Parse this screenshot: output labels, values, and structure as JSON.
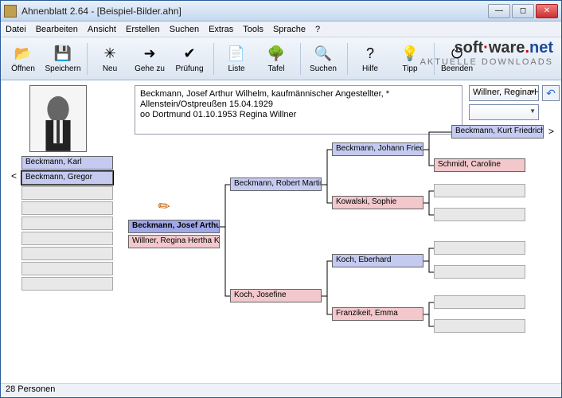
{
  "title": "Ahnenblatt 2.64 - [Beispiel-Bilder.ahn]",
  "menu": [
    "Datei",
    "Bearbeiten",
    "Ansicht",
    "Erstellen",
    "Suchen",
    "Extras",
    "Tools",
    "Sprache",
    "?"
  ],
  "toolbar": {
    "oeffnen": {
      "label": "Öffnen",
      "icon": "📂"
    },
    "speichern": {
      "label": "Speichern",
      "icon": "💾"
    },
    "neu": {
      "label": "Neu",
      "icon": "✳"
    },
    "gehezu": {
      "label": "Gehe zu",
      "icon": "➜"
    },
    "pruefung": {
      "label": "Prüfung",
      "icon": "✔"
    },
    "liste": {
      "label": "Liste",
      "icon": "📄"
    },
    "tafel": {
      "label": "Tafel",
      "icon": "🌳"
    },
    "suchen": {
      "label": "Suchen",
      "icon": "🔍"
    },
    "hilfe": {
      "label": "Hilfe",
      "icon": "?"
    },
    "tipp": {
      "label": "Tipp",
      "icon": "💡"
    },
    "beenden": {
      "label": "Beenden",
      "icon": "⏻"
    }
  },
  "brand": {
    "l1": "soft",
    "l2": "ware",
    "l3": "net",
    "sub": "AKTUELLE DOWNLOADS"
  },
  "info": {
    "line1": "Beckmann, Josef Arthur Wilhelm, kaufmännischer Angestellter, *",
    "line2": "Allenstein/Ostpreußen 15.04.1929",
    "line3": "oo Dortmund 01.10.1953 Regina Willner"
  },
  "nav": {
    "combo1": "Willner, Regina Herth",
    "combo2": "",
    "link": "Beckmann, Kurt Friedrich"
  },
  "siblings": [
    "Beckmann, Karl",
    "Beckmann, Gregor",
    "",
    "",
    "",
    "",
    "",
    "",
    ""
  ],
  "focus": {
    "self": "Beckmann, Josef Arthu",
    "spouse": "Willner, Regina Hertha K"
  },
  "gen2": {
    "father": "Beckmann, Robert Martin",
    "mother": "Koch, Josefine"
  },
  "gen3": {
    "pf": "Beckmann, Johann Fried",
    "pm": "Kowalski, Sophie",
    "mf": "Koch, Eberhard",
    "mm": "Franzikeit, Emma"
  },
  "gen4": {
    "ppm": "Schmidt, Caroline"
  },
  "status": "28 Personen"
}
